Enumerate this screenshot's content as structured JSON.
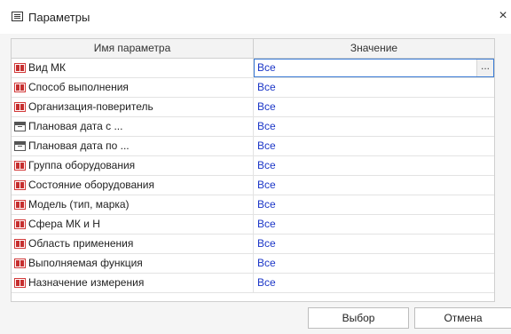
{
  "window": {
    "title": "Параметры",
    "close_glyph": "×",
    "app_icon": "form-icon"
  },
  "table": {
    "headers": [
      "Имя параметра",
      "Значение"
    ],
    "rows": [
      {
        "name": "Вид МК",
        "value": "Все",
        "icon": "text-param-icon",
        "selected": true
      },
      {
        "name": "Способ выполнения",
        "value": "Все",
        "icon": "text-param-icon"
      },
      {
        "name": "Организация-поверитель",
        "value": "Все",
        "icon": "text-param-icon"
      },
      {
        "name": "Плановая дата с ...",
        "value": "Все",
        "icon": "calendar-icon"
      },
      {
        "name": "Плановая дата по ...",
        "value": "Все",
        "icon": "calendar-icon"
      },
      {
        "name": "Группа оборудования",
        "value": "Все",
        "icon": "text-param-icon"
      },
      {
        "name": "Состояние оборудования",
        "value": "Все",
        "icon": "text-param-icon"
      },
      {
        "name": "Модель (тип, марка)",
        "value": "Все",
        "icon": "text-param-icon"
      },
      {
        "name": "Сфера МК и Н",
        "value": "Все",
        "icon": "text-param-icon"
      },
      {
        "name": "Область применения",
        "value": "Все",
        "icon": "text-param-icon"
      },
      {
        "name": "Выполняемая функция",
        "value": "Все",
        "icon": "text-param-icon"
      },
      {
        "name": "Назначение измерения",
        "value": "Все",
        "icon": "text-param-icon"
      }
    ],
    "ellipsis_label": "..."
  },
  "buttons": {
    "select_label": "Выбор",
    "cancel_label": "Отмена"
  },
  "colors": {
    "value_text": "#1a35c7",
    "text_icon": "#c62e2e",
    "selection_outline": "#3a7bd5"
  }
}
